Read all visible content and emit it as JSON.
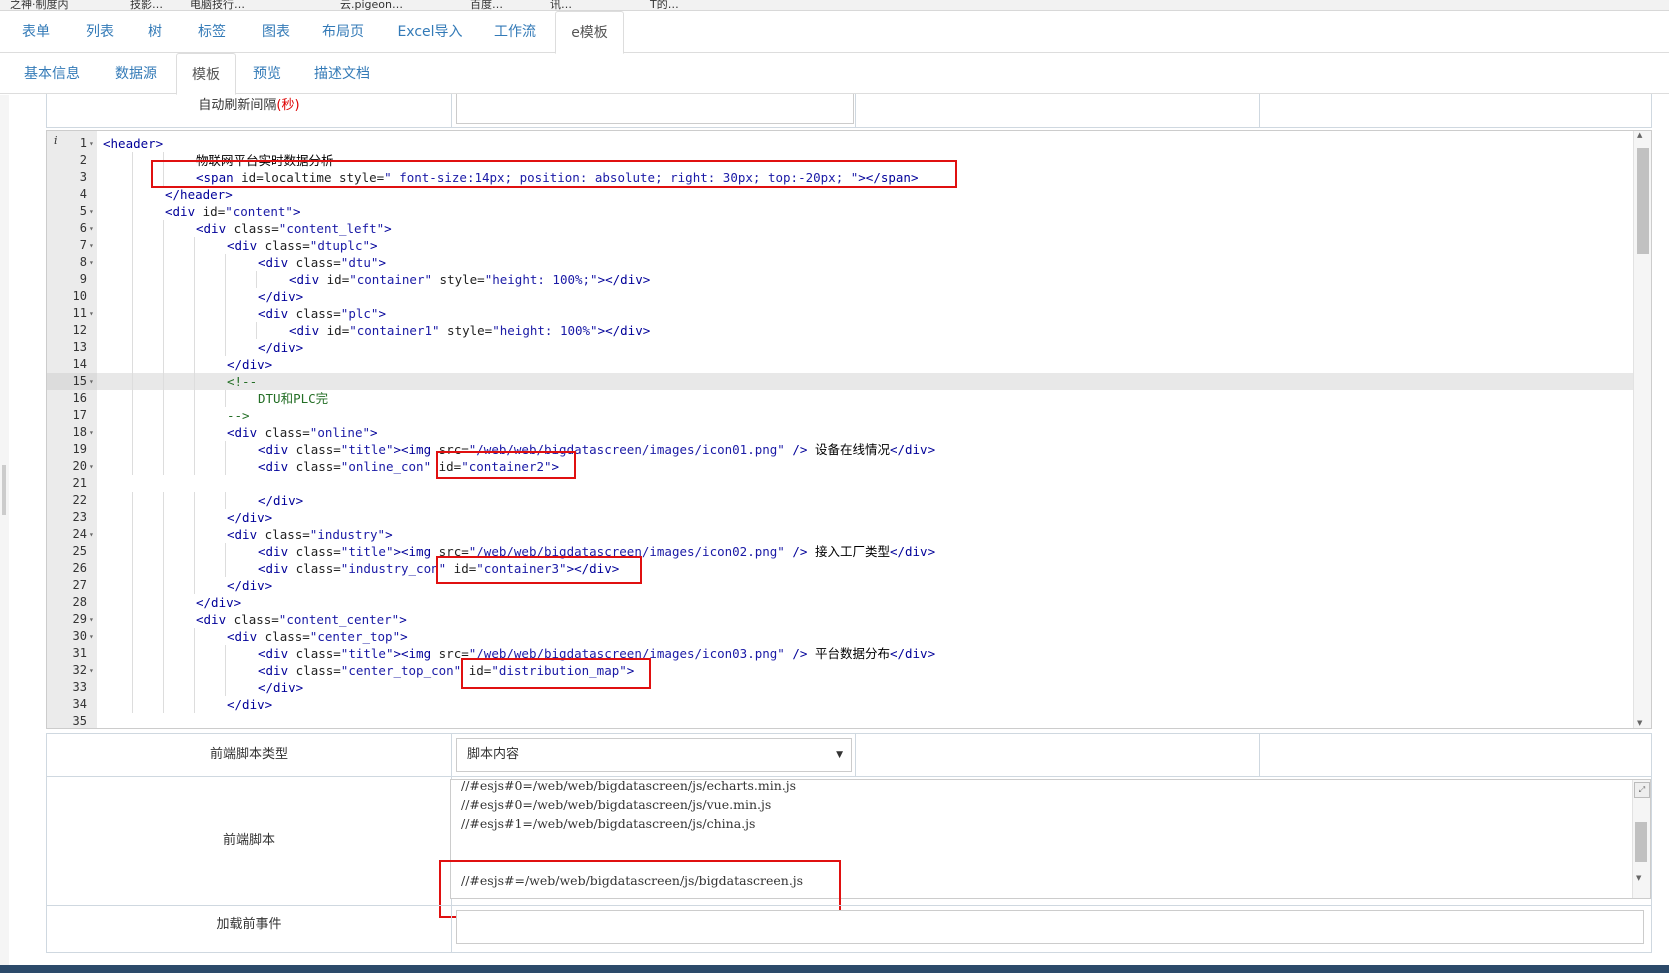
{
  "bookmarks": [
    "之神·制度内",
    "技影…",
    "电脑技行…",
    "云.pigeon…",
    "百度…",
    "讯…",
    "T的…"
  ],
  "main_tabs": [
    {
      "label": "表单",
      "active": false
    },
    {
      "label": "列表",
      "active": false
    },
    {
      "label": "树",
      "active": false
    },
    {
      "label": "标签",
      "active": false
    },
    {
      "label": "图表",
      "active": false
    },
    {
      "label": "布局页",
      "active": false
    },
    {
      "label": "Excel导入",
      "active": false
    },
    {
      "label": "工作流",
      "active": false
    },
    {
      "label": "e模板",
      "active": true
    }
  ],
  "sub_tabs": [
    {
      "label": "基本信息",
      "active": false
    },
    {
      "label": "数据源",
      "active": false
    },
    {
      "label": "模板",
      "active": true
    },
    {
      "label": "预览",
      "active": false
    },
    {
      "label": "描述文档",
      "active": false
    }
  ],
  "refresh_row": {
    "label": "自动刷新间隔",
    "label_suffix": "(秒)",
    "value": ""
  },
  "editor": {
    "active_line": 15,
    "lines": [
      {
        "n": "1",
        "fold": true,
        "indent": 0,
        "tokens": [
          [
            "tag",
            "<header>"
          ]
        ]
      },
      {
        "n": "2",
        "fold": false,
        "indent": 3,
        "tokens": [
          [
            "txt",
            "物联网平台实时数据分析"
          ]
        ]
      },
      {
        "n": "3",
        "fold": false,
        "indent": 3,
        "tokens": [
          [
            "tag",
            "<span "
          ],
          [
            "attr",
            "id=localtime style="
          ],
          [
            "str",
            "\" font-size:14px; position: absolute; right: 30px; top:-20px; \""
          ],
          [
            "tag",
            "></span>"
          ]
        ]
      },
      {
        "n": "4",
        "fold": false,
        "indent": 2,
        "tokens": [
          [
            "tag",
            "</header>"
          ]
        ]
      },
      {
        "n": "5",
        "fold": true,
        "indent": 2,
        "tokens": [
          [
            "tag",
            "<div "
          ],
          [
            "attr",
            "id="
          ],
          [
            "str",
            "\"content\""
          ],
          [
            "tag",
            ">"
          ]
        ]
      },
      {
        "n": "6",
        "fold": true,
        "indent": 3,
        "tokens": [
          [
            "tag",
            "<div "
          ],
          [
            "attr",
            "class="
          ],
          [
            "str",
            "\"content_left\""
          ],
          [
            "tag",
            ">"
          ]
        ]
      },
      {
        "n": "7",
        "fold": true,
        "indent": 4,
        "tokens": [
          [
            "tag",
            "<div "
          ],
          [
            "attr",
            "class="
          ],
          [
            "str",
            "\"dtuplc\""
          ],
          [
            "tag",
            ">"
          ]
        ]
      },
      {
        "n": "8",
        "fold": true,
        "indent": 5,
        "tokens": [
          [
            "tag",
            "<div "
          ],
          [
            "attr",
            "class="
          ],
          [
            "str",
            "\"dtu\""
          ],
          [
            "tag",
            ">"
          ]
        ]
      },
      {
        "n": "9",
        "fold": false,
        "indent": 6,
        "tokens": [
          [
            "tag",
            "<div "
          ],
          [
            "attr",
            "id="
          ],
          [
            "str",
            "\"container\""
          ],
          [
            "attr",
            " style="
          ],
          [
            "str",
            "\"height: 100%;\""
          ],
          [
            "tag",
            "></div>"
          ]
        ]
      },
      {
        "n": "10",
        "fold": false,
        "indent": 5,
        "tokens": [
          [
            "tag",
            "</div>"
          ]
        ]
      },
      {
        "n": "11",
        "fold": true,
        "indent": 5,
        "tokens": [
          [
            "tag",
            "<div "
          ],
          [
            "attr",
            "class="
          ],
          [
            "str",
            "\"plc\""
          ],
          [
            "tag",
            ">"
          ]
        ]
      },
      {
        "n": "12",
        "fold": false,
        "indent": 6,
        "tokens": [
          [
            "tag",
            "<div "
          ],
          [
            "attr",
            "id="
          ],
          [
            "str",
            "\"container1\""
          ],
          [
            "attr",
            " style="
          ],
          [
            "str",
            "\"height: 100%\""
          ],
          [
            "tag",
            "></div>"
          ]
        ]
      },
      {
        "n": "13",
        "fold": false,
        "indent": 5,
        "tokens": [
          [
            "tag",
            "</div>"
          ]
        ]
      },
      {
        "n": "14",
        "fold": false,
        "indent": 4,
        "tokens": [
          [
            "tag",
            "</div>"
          ]
        ]
      },
      {
        "n": "15",
        "fold": true,
        "indent": 4,
        "tokens": [
          [
            "cmt",
            "<!--"
          ]
        ]
      },
      {
        "n": "16",
        "fold": false,
        "indent": 5,
        "tokens": [
          [
            "cmt",
            "DTU和PLC完"
          ]
        ]
      },
      {
        "n": "17",
        "fold": false,
        "indent": 4,
        "tokens": [
          [
            "cmt",
            "-->"
          ]
        ]
      },
      {
        "n": "18",
        "fold": true,
        "indent": 4,
        "tokens": [
          [
            "tag",
            "<div "
          ],
          [
            "attr",
            "class="
          ],
          [
            "str",
            "\"online\""
          ],
          [
            "tag",
            ">"
          ]
        ]
      },
      {
        "n": "19",
        "fold": false,
        "indent": 5,
        "tokens": [
          [
            "tag",
            "<div "
          ],
          [
            "attr",
            "class="
          ],
          [
            "str",
            "\"title\""
          ],
          [
            "tag",
            "><img "
          ],
          [
            "attr",
            "src="
          ],
          [
            "str",
            "\"/web/web/bigdatascreen/images/icon01.png\""
          ],
          [
            "tag",
            " /> "
          ],
          [
            "txt",
            "设备在线情况"
          ],
          [
            "tag",
            "</div>"
          ]
        ]
      },
      {
        "n": "20",
        "fold": true,
        "indent": 5,
        "tokens": [
          [
            "tag",
            "<div "
          ],
          [
            "attr",
            "class="
          ],
          [
            "str",
            "\"online_con\""
          ],
          [
            "attr",
            " id="
          ],
          [
            "str",
            "\"container2\""
          ],
          [
            "tag",
            ">"
          ]
        ]
      },
      {
        "n": "21",
        "fold": false,
        "indent": 0,
        "tokens": []
      },
      {
        "n": "22",
        "fold": false,
        "indent": 5,
        "tokens": [
          [
            "tag",
            "</div>"
          ]
        ]
      },
      {
        "n": "23",
        "fold": false,
        "indent": 4,
        "tokens": [
          [
            "tag",
            "</div>"
          ]
        ]
      },
      {
        "n": "24",
        "fold": true,
        "indent": 4,
        "tokens": [
          [
            "tag",
            "<div "
          ],
          [
            "attr",
            "class="
          ],
          [
            "str",
            "\"industry\""
          ],
          [
            "tag",
            ">"
          ]
        ]
      },
      {
        "n": "25",
        "fold": false,
        "indent": 5,
        "tokens": [
          [
            "tag",
            "<div "
          ],
          [
            "attr",
            "class="
          ],
          [
            "str",
            "\"title\""
          ],
          [
            "tag",
            "><img "
          ],
          [
            "attr",
            "src="
          ],
          [
            "str",
            "\"/web/web/bigdatascreen/images/icon02.png\""
          ],
          [
            "tag",
            " /> "
          ],
          [
            "txt",
            "接入工厂类型"
          ],
          [
            "tag",
            "</div>"
          ]
        ]
      },
      {
        "n": "26",
        "fold": false,
        "indent": 5,
        "tokens": [
          [
            "tag",
            "<div "
          ],
          [
            "attr",
            "class="
          ],
          [
            "str",
            "\"industry_con\""
          ],
          [
            "attr",
            " id="
          ],
          [
            "str",
            "\"container3\""
          ],
          [
            "tag",
            "></div>"
          ]
        ]
      },
      {
        "n": "27",
        "fold": false,
        "indent": 4,
        "tokens": [
          [
            "tag",
            "</div>"
          ]
        ]
      },
      {
        "n": "28",
        "fold": false,
        "indent": 3,
        "tokens": [
          [
            "tag",
            "</div>"
          ]
        ]
      },
      {
        "n": "29",
        "fold": true,
        "indent": 3,
        "tokens": [
          [
            "tag",
            "<div "
          ],
          [
            "attr",
            "class="
          ],
          [
            "str",
            "\"content_center\""
          ],
          [
            "tag",
            ">"
          ]
        ]
      },
      {
        "n": "30",
        "fold": true,
        "indent": 4,
        "tokens": [
          [
            "tag",
            "<div "
          ],
          [
            "attr",
            "class="
          ],
          [
            "str",
            "\"center_top\""
          ],
          [
            "tag",
            ">"
          ]
        ]
      },
      {
        "n": "31",
        "fold": false,
        "indent": 5,
        "tokens": [
          [
            "tag",
            "<div "
          ],
          [
            "attr",
            "class="
          ],
          [
            "str",
            "\"title\""
          ],
          [
            "tag",
            "><img "
          ],
          [
            "attr",
            "src="
          ],
          [
            "str",
            "\"/web/web/bigdatascreen/images/icon03.png\""
          ],
          [
            "tag",
            " /> "
          ],
          [
            "txt",
            "平台数据分布"
          ],
          [
            "tag",
            "</div>"
          ]
        ]
      },
      {
        "n": "32",
        "fold": true,
        "indent": 5,
        "tokens": [
          [
            "tag",
            "<div "
          ],
          [
            "attr",
            "class="
          ],
          [
            "str",
            "\"center_top_con\""
          ],
          [
            "attr",
            " id="
          ],
          [
            "str",
            "\"distribution_map\""
          ],
          [
            "tag",
            ">"
          ]
        ]
      },
      {
        "n": "33",
        "fold": false,
        "indent": 5,
        "tokens": [
          [
            "tag",
            "</div>"
          ]
        ]
      },
      {
        "n": "34",
        "fold": false,
        "indent": 4,
        "tokens": [
          [
            "tag",
            "</div>"
          ]
        ]
      },
      {
        "n": "35",
        "fold": false,
        "indent": 0,
        "tokens": []
      }
    ]
  },
  "script_type_row": {
    "label": "前端脚本类型",
    "selected": "脚本内容"
  },
  "script_row": {
    "label": "前端脚本",
    "lines": [
      "//#esjs#0=/web/web/bigdatascreen/js/echarts.min.js",
      "//#esjs#0=/web/web/bigdatascreen/js/vue.min.js",
      "//#esjs#1=/web/web/bigdatascreen/js/china.js",
      "",
      "",
      "//#esjs#=/web/web/bigdatascreen/js/bigdatascreen.js"
    ]
  },
  "preload_row": {
    "label": "加载前事件",
    "value": ""
  },
  "colors": {
    "link": "#337ab7",
    "highlight_box": "#e01010",
    "border": "#cfd8e0"
  }
}
